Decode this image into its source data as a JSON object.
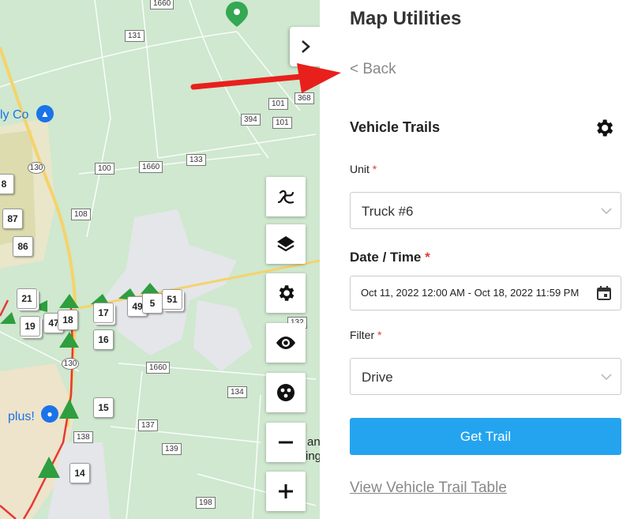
{
  "panel": {
    "title": "Map Utilities",
    "back_label": "< Back",
    "section_title": "Vehicle Trails",
    "unit": {
      "label": "Unit",
      "required": "*",
      "value": "Truck #6"
    },
    "date_time": {
      "label": "Date / Time",
      "required": "*",
      "value": "Oct 11, 2022 12:00 AM - Oct 18, 2022 11:59 PM"
    },
    "filter": {
      "label": "Filter",
      "required": "*",
      "value": "Drive"
    },
    "get_trail_label": "Get Trail",
    "view_table_label": "View Vehicle Trail Table"
  },
  "map": {
    "route_shields": [
      "1660",
      "131",
      "101",
      "368",
      "394",
      "101",
      "133",
      "100",
      "1660",
      "108",
      "132",
      "1660",
      "134",
      "138",
      "137",
      "139",
      "198"
    ],
    "route_circles": [
      "130",
      "130"
    ],
    "markers": [
      "8",
      "87",
      "86",
      "21",
      "19",
      "47",
      "18",
      "17",
      "49",
      "5",
      "51",
      "16",
      "15",
      "14"
    ],
    "place_labels": {
      "top": "ly Co",
      "bottom": "plus!"
    },
    "partial_labels": [
      "an",
      "ing"
    ],
    "controls": [
      "route-icon",
      "layers-icon",
      "gear-icon",
      "eye-icon",
      "palette-icon",
      "zoom-out-icon",
      "zoom-in-icon"
    ],
    "toggle_icon": "chevron-right-icon"
  },
  "colors": {
    "map_green": "#cfe8cf",
    "trail_red": "#e53935",
    "trail_arrow_green": "#2e9e3e",
    "accent_button": "#24a4ef",
    "required_star": "#e53935",
    "annotation_arrow": "#e8201c"
  }
}
